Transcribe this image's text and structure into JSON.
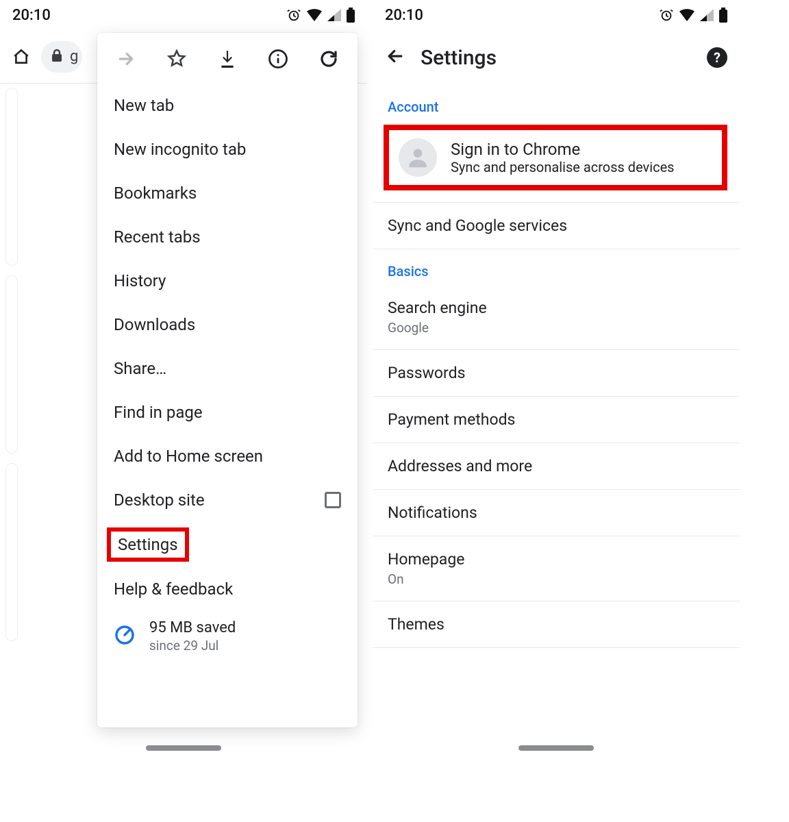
{
  "status": {
    "time": "20:10"
  },
  "left": {
    "url_prefix": "g",
    "menu_items": [
      "New tab",
      "New incognito tab",
      "Bookmarks",
      "Recent tabs",
      "History",
      "Downloads",
      "Share…",
      "Find in page",
      "Add to Home screen",
      "Desktop site",
      "Settings",
      "Help & feedback"
    ],
    "data_saved": {
      "amount": "95 MB saved",
      "since": "since 29 Jul"
    }
  },
  "right": {
    "title": "Settings",
    "section_account": "Account",
    "signin": {
      "title": "Sign in to Chrome",
      "sub": "Sync and personalise across devices"
    },
    "sync_row": "Sync and Google services",
    "section_basics": "Basics",
    "search_engine": {
      "title": "Search engine",
      "sub": "Google"
    },
    "passwords": "Passwords",
    "payment": "Payment methods",
    "addresses": "Addresses and more",
    "notifications": "Notifications",
    "homepage": {
      "title": "Homepage",
      "sub": "On"
    },
    "themes": "Themes"
  }
}
